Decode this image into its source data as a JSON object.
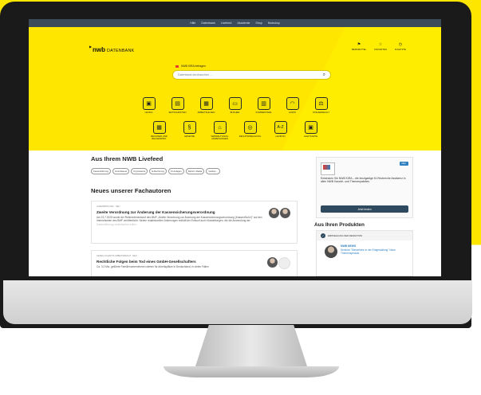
{
  "nav": [
    "Hilfe",
    "Datenbank",
    "Livefeed",
    "Akademie",
    "Shop",
    "Nwbshop"
  ],
  "brand": {
    "nwb": "nwb",
    "db": "DATENBANK"
  },
  "toplinks": [
    {
      "icon": "bookmark-icon",
      "glyph": "⚑",
      "label": "MERKZETTEL"
    },
    {
      "icon": "star-icon",
      "glyph": "☆",
      "label": "FAVORITEN"
    },
    {
      "icon": "clock-icon",
      "glyph": "◷",
      "label": "ZULETZTE"
    }
  ],
  "kira": {
    "prompt": "NWB KIRA befragen"
  },
  "search": {
    "placeholder": "Datenbank durchsuchen ..."
  },
  "categories_row1": [
    {
      "name": "lexikon",
      "glyph": "▣",
      "label": "LEXIKA"
    },
    {
      "name": "zeitschriften",
      "glyph": "▤",
      "label": "ZEITSCHRIFTEN"
    },
    {
      "name": "arbeitshilfen",
      "glyph": "▦",
      "label": "ARBEITSHILFEN"
    },
    {
      "name": "buecher",
      "glyph": "▭",
      "label": "BÜCHER"
    },
    {
      "name": "kommentare",
      "glyph": "▥",
      "label": "KOMMENTARE"
    },
    {
      "name": "audio",
      "glyph": "◠",
      "label": "AUDIO"
    },
    {
      "name": "steuerrecht",
      "glyph": "⚖",
      "label": "STEUERRECHT"
    }
  ],
  "categories_row2": [
    {
      "name": "rechner",
      "glyph": "▦",
      "label": "RECHNER UND RECHENPRO."
    },
    {
      "name": "gesetze",
      "glyph": "§",
      "label": "GESETZE"
    },
    {
      "name": "verwaltung",
      "glyph": "⌂",
      "label": "VERWALTUNGS-ANWEISUNGEN"
    },
    {
      "name": "rechtsprechung",
      "glyph": "◎",
      "label": "RECHTSPRECHUNG"
    },
    {
      "name": "az",
      "glyph": "A-Z",
      "label": "LEXIKON"
    },
    {
      "name": "gleitkarte",
      "glyph": "▣",
      "label": "GLEITKARTE"
    }
  ],
  "livefeed": {
    "title": "Aus Ihrem NWB Livefeed",
    "chips": [
      "Kassenführung",
      "Grundsteuer",
      "Kryptowerte",
      "E-Rechnung",
      "KI-Anlagen",
      "Reform-Radar",
      "Geldsp..."
    ]
  },
  "fachautoren": {
    "title": "Neues unserer Fachautoren",
    "cards": [
      {
        "meta": "AUßENPRÜFUNG · NEU",
        "title": "Zweite Verordnung zur Änderung der Kassensicherungsverordnung",
        "body": "Am 23.7.2025 wurde der Referentenentwurf des BMF „Zweite Verordnung zur Änderung der Kassensicherungsverordnung (KassenSichV)\" auf den Internetseiten des BMF veröffentlicht. Neben redaktionellen Änderungen enthält der Entwurf auch Klarstellungen, die die Anwendung der",
        "fade": "Kassenführung vereinfachen sollen."
      },
      {
        "meta": "GESELLSCHAFTS-ARBEITSRECHT · NEU",
        "title": "Rechtliche Folgen beim Tod eines GmbH-Gesellschafters",
        "body": "Ca. 3,2 Mio. geführte Familienunternehmen stehen für Arbeitsplätze in Deutschland, in vielen Fällen",
        "fade": ""
      }
    ]
  },
  "kira_card": {
    "badge": "NEU",
    "text": "Entdecken Sie NWB KIRA – die einzigartige KI-Recherche Assistenz in allen NWB Kanzlei- und Themenpaketen.",
    "button": "Jetzt testen"
  },
  "produkte": {
    "title": "Aus Ihren Produkten",
    "head": "EMPFEHLUNG DER REDAKTION",
    "name": "NWB NEWS",
    "desc": "Seminar \"Steuerliche in der Erbgestaltung\" Neue Themenspecials"
  }
}
